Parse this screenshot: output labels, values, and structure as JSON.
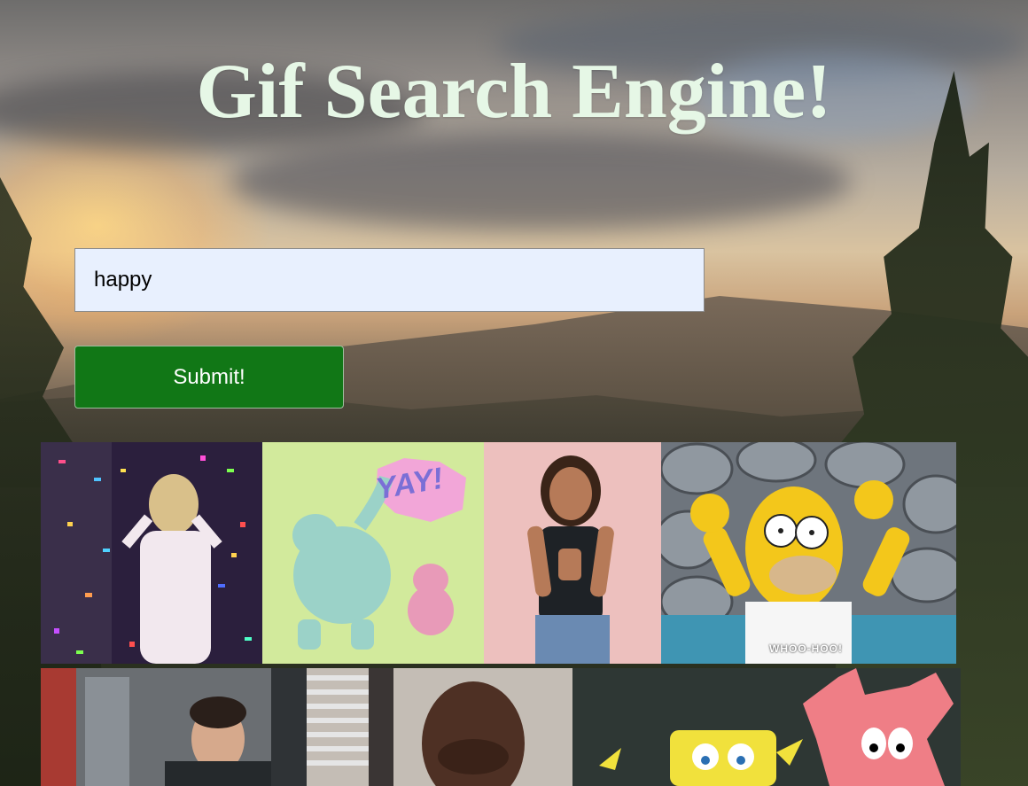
{
  "header": {
    "title": "Gif Search Engine!"
  },
  "search": {
    "value": "happy",
    "submit_label": "Submit!"
  },
  "results": [
    {
      "name": "confetti-celebration-gif"
    },
    {
      "name": "elephant-piggie-yay-gif",
      "caption": "YAY!"
    },
    {
      "name": "woman-clapping-gif"
    },
    {
      "name": "homer-simpson-woohoo-gif",
      "caption": "WHOO-HOO!"
    },
    {
      "name": "office-man-smiling-gif"
    },
    {
      "name": "office-bald-man-smiling-gif"
    },
    {
      "name": "spongebob-patrick-celebrating-gif"
    }
  ]
}
